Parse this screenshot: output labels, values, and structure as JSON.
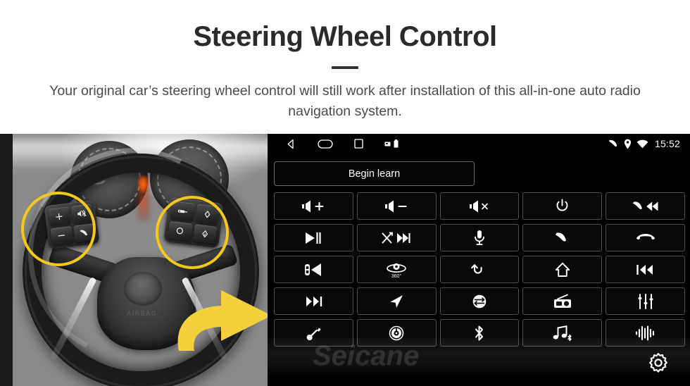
{
  "header": {
    "title": "Steering Wheel Control",
    "subtitle": "Your original car’s steering wheel control will still work after installation of this all-in-one auto radio navigation system."
  },
  "colors": {
    "accent_yellow": "#F2C81E",
    "arrow_yellow": "#F5D03C",
    "screen_background": "#000000",
    "button_border": "#4E4E4E",
    "title_text": "#2B2B2B",
    "subtitle_text": "#4A4A4A"
  },
  "photo": {
    "alt": "Car steering wheel with highlighted control button clusters",
    "airbag_text": "AIRBAG",
    "highlight_left_label": "left-steering-wheel-button-cluster",
    "highlight_right_label": "right-steering-wheel-button-cluster",
    "arrow_label": "points-to-head-unit",
    "left_cluster_keys": [
      {
        "name": "volume-up-key",
        "glyph": "+"
      },
      {
        "name": "mute-key",
        "glyph": "mute"
      },
      {
        "name": "volume-down-key",
        "glyph": "−"
      },
      {
        "name": "call-key",
        "glyph": "phone"
      }
    ],
    "right_cluster_keys": [
      {
        "name": "mode-key",
        "glyph": "mode"
      },
      {
        "name": "up-key",
        "glyph": "up"
      },
      {
        "name": "menu-key",
        "glyph": "circle"
      },
      {
        "name": "down-key",
        "glyph": "down"
      }
    ]
  },
  "head_unit": {
    "statusbar": {
      "nav_icons": [
        {
          "name": "back-icon",
          "label": "Back"
        },
        {
          "name": "home-icon",
          "label": "Home"
        },
        {
          "name": "recents-icon",
          "label": "Recent apps"
        },
        {
          "name": "sdcard-icon",
          "label": "SD card"
        },
        {
          "name": "battery-icon",
          "label": "Battery"
        }
      ],
      "status_icons": [
        {
          "name": "phone-status-icon",
          "label": "Phone"
        },
        {
          "name": "location-status-icon",
          "label": "GPS"
        },
        {
          "name": "wifi-status-icon",
          "label": "Wi-Fi"
        }
      ],
      "time": "15:52"
    },
    "begin_learn_label": "Begin learn",
    "watermark": "Seicane",
    "settings_label": "Settings",
    "buttons": [
      {
        "name": "volume-up-button",
        "icon": "speaker-plus",
        "label": "Volume up"
      },
      {
        "name": "volume-down-button",
        "icon": "speaker-minus",
        "label": "Volume down"
      },
      {
        "name": "mute-button",
        "icon": "speaker-x",
        "label": "Mute"
      },
      {
        "name": "power-button",
        "icon": "power",
        "label": "Power"
      },
      {
        "name": "call-previous-button",
        "icon": "phone-prev",
        "label": "Call / previous"
      },
      {
        "name": "play-pause-button",
        "icon": "play-pause",
        "label": "Play / pause"
      },
      {
        "name": "shuffle-next-button",
        "icon": "shuffle-next",
        "label": "Shuffle / next"
      },
      {
        "name": "voice-mic-button",
        "icon": "microphone",
        "label": "Voice command"
      },
      {
        "name": "answer-call-button",
        "icon": "phone",
        "label": "Answer call"
      },
      {
        "name": "hang-up-button",
        "icon": "phone-hangup",
        "label": "Hang up"
      },
      {
        "name": "rear-camera-button",
        "icon": "rear-camera",
        "label": "Rear camera"
      },
      {
        "name": "camera-360-button",
        "icon": "camera-360",
        "label": "360° camera"
      },
      {
        "name": "back-button",
        "icon": "back-arrow",
        "label": "Back"
      },
      {
        "name": "home-button",
        "icon": "home",
        "label": "Home"
      },
      {
        "name": "previous-track-button",
        "icon": "prev-track",
        "label": "Previous track"
      },
      {
        "name": "next-track-button",
        "icon": "next-track",
        "label": "Next track"
      },
      {
        "name": "navigation-button",
        "icon": "navigation",
        "label": "Navigation"
      },
      {
        "name": "source-swap-button",
        "icon": "source-swap",
        "label": "Source"
      },
      {
        "name": "radio-button",
        "icon": "radio",
        "label": "Radio"
      },
      {
        "name": "equalizer-button",
        "icon": "equalizer",
        "label": "Equalizer"
      },
      {
        "name": "aux-cable-button",
        "icon": "aux-cable",
        "label": "AUX"
      },
      {
        "name": "dial-knob-button",
        "icon": "dial-knob",
        "label": "Dial"
      },
      {
        "name": "bluetooth-button",
        "icon": "bluetooth",
        "label": "Bluetooth"
      },
      {
        "name": "bt-music-button",
        "icon": "bt-music",
        "label": "Bluetooth music"
      },
      {
        "name": "audio-wave-button",
        "icon": "audio-wave",
        "label": "Audio"
      }
    ]
  }
}
